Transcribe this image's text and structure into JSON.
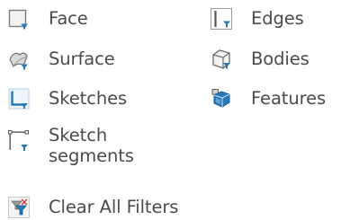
{
  "filters": {
    "left": [
      {
        "label": "Face",
        "icon": "face-filter-icon"
      },
      {
        "label": "Surface",
        "icon": "surface-filter-icon"
      },
      {
        "label": "Sketches",
        "icon": "sketches-filter-icon"
      },
      {
        "label_line1": "Sketch",
        "label_line2": "segments",
        "icon": "sketch-segments-filter-icon"
      }
    ],
    "right": [
      {
        "label": "Edges",
        "icon": "edges-filter-icon"
      },
      {
        "label": "Bodies",
        "icon": "bodies-filter-icon"
      },
      {
        "label": "Features",
        "icon": "features-filter-icon"
      }
    ]
  },
  "clear": {
    "label": "Clear All Filters",
    "icon": "clear-filters-icon"
  },
  "colors": {
    "text": "#4b4b4b",
    "accent": "#2a78b8",
    "icon_gray": "#8a8a8a",
    "icon_light": "#e6e6e6"
  }
}
